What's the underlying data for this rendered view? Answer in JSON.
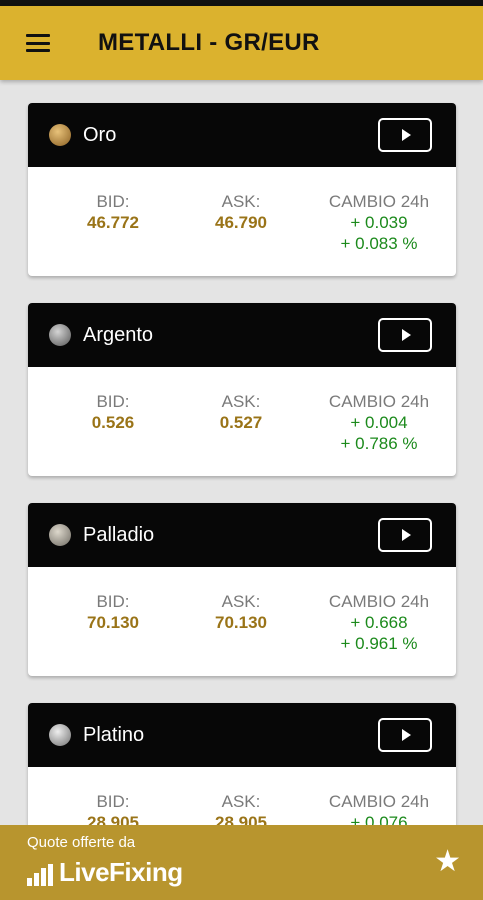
{
  "app_bar": {
    "title": "METALLI - GR/EUR",
    "menu_icon": "hamburger-menu-icon"
  },
  "labels": {
    "bid": "BID:",
    "ask": "ASK:",
    "change": "CAMBIO 24h"
  },
  "metals": [
    {
      "name": "Oro",
      "coin_color": "#b8893d",
      "bid": "46.772",
      "ask": "46.790",
      "change_abs": "+ 0.039",
      "change_pct": "+ 0.083 %"
    },
    {
      "name": "Argento",
      "coin_color": "#9a9a9a",
      "bid": "0.526",
      "ask": "0.527",
      "change_abs": "+ 0.004",
      "change_pct": "+ 0.786 %"
    },
    {
      "name": "Palladio",
      "coin_color": "#b0aca4",
      "bid": "70.130",
      "ask": "70.130",
      "change_abs": "+ 0.668",
      "change_pct": "+ 0.961 %"
    },
    {
      "name": "Platino",
      "coin_color": "#c4c4c4",
      "bid": "28.905",
      "ask": "28.905",
      "change_abs": "+ 0.076",
      "change_pct": ""
    }
  ],
  "footer": {
    "caption": "Quote offerte da",
    "brand": "LiveFixing",
    "favorite_icon": "star-icon"
  },
  "colors": {
    "accent": "#dbb22e",
    "footer": "#b8952e",
    "value": "#9a7418",
    "positive": "#1c8a1c",
    "header": "#070707"
  }
}
